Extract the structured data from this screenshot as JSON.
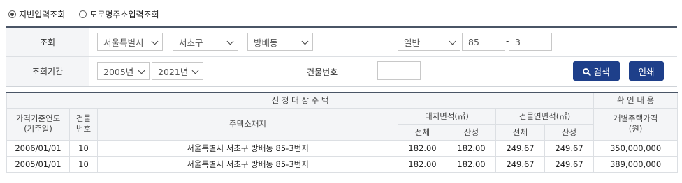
{
  "radios": [
    {
      "label": "지번입력조회",
      "selected": true
    },
    {
      "label": "도로명주소입력조회",
      "selected": false
    }
  ],
  "search": {
    "row1_label": "조회",
    "city": "서울특별시",
    "district": "서초구",
    "dong": "방배동",
    "lot_type": "일반",
    "main_number": "85",
    "dash": "-",
    "sub_number": "3",
    "row2_label": "조회기간",
    "year_from": "2005년",
    "year_to": "2021년",
    "building_label": "건물번호",
    "building_number": "",
    "search_button": "검색",
    "print_button": "인쇄"
  },
  "table": {
    "group_main": "신 청 대 상 주 택",
    "group_confirm": "확 인 내 용",
    "col_base_year": "가격기준연도\n(기준일)",
    "col_building": "건물\n번호",
    "col_address": "주택소재지",
    "col_land_area": "대지면적(㎡)",
    "col_bldg_area": "건물연면적(㎡)",
    "col_price": "개별주택가격\n(원)",
    "sub_total": "전체",
    "sub_calc": "산정",
    "rows": [
      {
        "date": "2006/01/01",
        "bno": "10",
        "addr": "서울특별시 서초구 방배동 85-3번지",
        "land_total": "182.00",
        "land_calc": "182.00",
        "bldg_total": "249.67",
        "bldg_calc": "249.67",
        "price": "350,000,000"
      },
      {
        "date": "2005/01/01",
        "bno": "10",
        "addr": "서울특별시 서초구 방배동 85-3번지",
        "land_total": "182.00",
        "land_calc": "182.00",
        "bldg_total": "249.67",
        "bldg_calc": "249.67",
        "price": "389,000,000"
      }
    ]
  }
}
